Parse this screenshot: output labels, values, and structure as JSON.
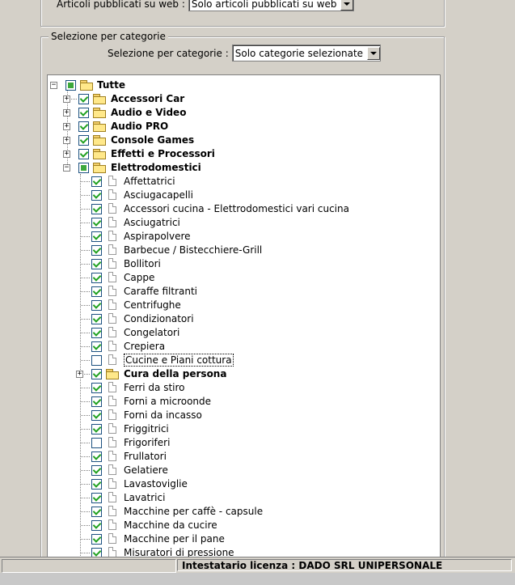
{
  "published_filter": {
    "label": "Articoli pubblicati su web :",
    "value": "Solo articoli pubblicati su web"
  },
  "category_section": {
    "legend": "Selezione per categorie",
    "label": "Selezione per categorie :",
    "value": "Solo categorie selezionate"
  },
  "tree": {
    "root": "Tutte",
    "groups": [
      "Accessori Car",
      "Audio e Video",
      "Audio PRO",
      "Console Games",
      "Effetti e Processori",
      "Elettrodomestici"
    ],
    "elettrodomestici_items": [
      "Affettatrici",
      "Asciugacapelli",
      "Accessori cucina - Elettrodomestici vari cucina",
      "Asciugatrici",
      "Aspirapolvere",
      "Barbecue / Bistecchiere-Grill",
      "Bollitori",
      "Cappe",
      "Caraffe filtranti",
      "Centrifughe",
      "Condizionatori",
      "Congelatori",
      "Crepiera",
      "Cucine e Piani cottura",
      "Cura della persona",
      "Ferri da stiro",
      "Forni a microonde",
      "Forni da incasso",
      "Friggitrici",
      "Frigoriferi",
      "Frullatori",
      "Gelatiere",
      "Lavastoviglie",
      "Lavatrici",
      "Macchine per caffè - capsule",
      "Macchine da cucire",
      "Macchine per il pane",
      "Misuratori di pressione"
    ]
  },
  "status": {
    "license": "Intestatario licenza : DADO SRL UNIPERSONALE"
  }
}
